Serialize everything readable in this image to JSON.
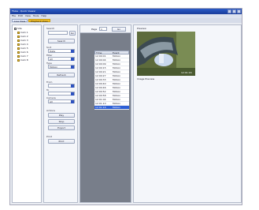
{
  "window": {
    "title": "Fluke · Quick Viewer"
  },
  "menu": [
    "File",
    "Edit",
    "View",
    "Tools",
    "Help"
  ],
  "toolbar": {
    "tabs": [
      "Live View",
      "Playback View"
    ],
    "active": 1
  },
  "tree": {
    "nodes": [
      {
        "label": "Site",
        "level": 0
      },
      {
        "label": "Cam 1",
        "level": 1
      },
      {
        "label": "Cam 2",
        "level": 1
      },
      {
        "label": "Cam 3",
        "level": 1
      },
      {
        "label": "Cam 4",
        "level": 1
      },
      {
        "label": "Cam 5",
        "level": 1
      },
      {
        "label": "Cam 6",
        "level": 1
      },
      {
        "label": "Cam 7",
        "level": 1
      },
      {
        "label": "Cam 8",
        "level": 1
      }
    ]
  },
  "controls": {
    "search_label": "Search",
    "go_label": "Go",
    "search_button": "Search",
    "sort_label": "Sort",
    "sort_value": "Date",
    "filter_label": "Filter",
    "filter_value": "All",
    "type_label": "Type",
    "type_value": "Motion",
    "refresh_button": "Refresh",
    "from_label": "From",
    "to_label": "To",
    "camera_label": "Camera",
    "camera_value": "All",
    "actions_label": "Actions",
    "btn_play": "Play",
    "btn_stop": "Stop",
    "btn_export": "Export",
    "print_label": "Print",
    "btn_print": "Print"
  },
  "results": {
    "page_label": "Page",
    "page_value": "1",
    "go_button": "Go",
    "columns": [
      "Time",
      "Event"
    ],
    "rows": [
      {
        "time": "12:00:01",
        "event": "Motion"
      },
      {
        "time": "12:00:04",
        "event": "Motion"
      },
      {
        "time": "12:00:09",
        "event": "Motion"
      },
      {
        "time": "12:00:15",
        "event": "Motion"
      },
      {
        "time": "12:00:21",
        "event": "Motion"
      },
      {
        "time": "12:00:27",
        "event": "Motion"
      },
      {
        "time": "12:00:33",
        "event": "Motion"
      },
      {
        "time": "12:00:40",
        "event": "Motion"
      },
      {
        "time": "12:00:46",
        "event": "Motion"
      },
      {
        "time": "12:00:52",
        "event": "Motion"
      },
      {
        "time": "12:00:58",
        "event": "Motion"
      },
      {
        "time": "12:01:04",
        "event": "Motion"
      },
      {
        "time": "12:01:10",
        "event": "Motion"
      },
      {
        "time": "12:01:16",
        "event": "Motion"
      }
    ],
    "selected_row": 13
  },
  "preview": {
    "header": "Preview",
    "timestamp": "12:01:16",
    "caption": "Image Preview"
  }
}
